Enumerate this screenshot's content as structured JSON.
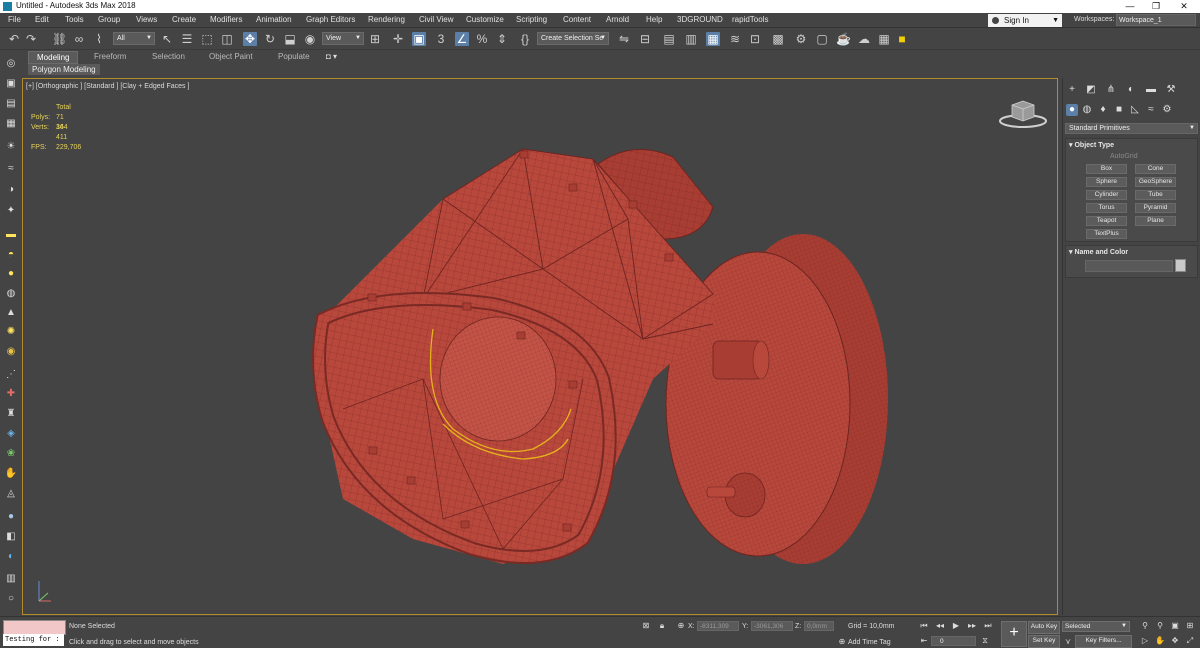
{
  "window": {
    "title": "Untitled - Autodesk 3ds Max 2018",
    "minimize_glyph": "—",
    "maximize_glyph": "❐",
    "close_glyph": "✕"
  },
  "menu": {
    "items": [
      "File",
      "Edit",
      "Tools",
      "Group",
      "Views",
      "Create",
      "Modifiers",
      "Animation",
      "Graph Editors",
      "Rendering",
      "Civil View",
      "Customize",
      "Scripting",
      "Content",
      "Arnold",
      "Help",
      "3DGROUND",
      "rapidTools"
    ],
    "sign_in": "Sign In",
    "workspaces_label": "Workspaces:",
    "workspace_value": "Workspace_1"
  },
  "toolbar": {
    "selection_filter": "All",
    "reference_coord": "View",
    "named_selection": "Create Selection Se",
    "snap_label": "3"
  },
  "ribbon": {
    "tabs": [
      "Modeling",
      "Freeform",
      "Selection",
      "Object Paint",
      "Populate"
    ],
    "active_tab": "Modeling",
    "sub_label": "Polygon Modeling"
  },
  "viewport": {
    "label": "[+] [Orthographic ] [Standard ] [Clay + Edged Faces ]",
    "stats": {
      "header": "Total",
      "polys_label": "Polys:",
      "polys_value": "71 144",
      "verts_label": "Verts:",
      "verts_value": "36 411",
      "fps_label": "FPS:",
      "fps_value": "229,706"
    },
    "model_color": "#b8473c",
    "wire_color": "#6e2520",
    "selection_color": "#e5b21c",
    "border_color": "#b38b2a"
  },
  "command_panel": {
    "category": "Standard Primitives",
    "object_type_title": "Object Type",
    "autogrid": "AutoGrid",
    "primitives": [
      "Box",
      "Cone",
      "Sphere",
      "GeoSphere",
      "Cylinder",
      "Tube",
      "Torus",
      "Pyramid",
      "Teapot",
      "Plane",
      "TextPlus"
    ],
    "name_color_title": "Name and Color"
  },
  "status": {
    "selection": "None Selected",
    "prompt": "Click and drag to select and move objects",
    "maxscript": "Testing for :",
    "x_label": "X:",
    "x_value": "-8311,309",
    "y_label": "Y:",
    "y_value": "-3061,306",
    "z_label": "Z:",
    "z_value": "0,0mm",
    "grid": "Grid = 10,0mm",
    "add_time_tag": "Add Time Tag",
    "frame": "0",
    "auto_key": "Auto Key",
    "set_key": "Set Key",
    "key_mode": "Selected",
    "key_filters": "Key Filters..."
  }
}
